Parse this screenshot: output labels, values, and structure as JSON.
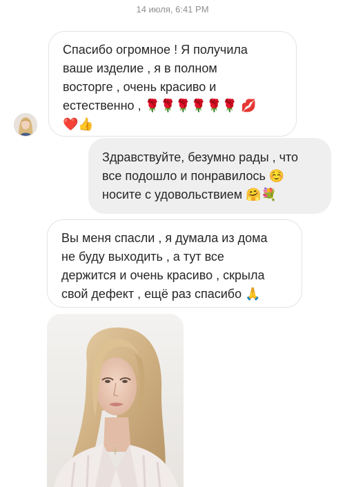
{
  "timestamp": "14 июля, 6:41 PM",
  "messages": [
    {
      "direction": "incoming",
      "lines": [
        "Спасибо огромное ! Я получила",
        "ваше изделие , я в полном",
        "восторге , очень красиво и",
        "естественно , 🌹🌹🌹🌹🌹🌹 💋",
        "❤️👍"
      ]
    },
    {
      "direction": "outgoing",
      "lines": [
        "Здравствуйте, безумно рады , что",
        "все подошло и понравилось ☺️",
        "носите с удовольствием 🤗💐"
      ]
    },
    {
      "direction": "incoming",
      "lines": [
        "Вы меня спасли , я думала из дома",
        "не буду выходить , а тут все",
        "держится и очень красиво , скрыла",
        "свой дефект , ещё раз спасибо 🙏"
      ]
    }
  ],
  "colors": {
    "incoming_bubble": "#ffffff",
    "incoming_border": "#e3e3e3",
    "outgoing_bubble": "#efefef",
    "text": "#262626",
    "timestamp": "#8e8e8e"
  },
  "images": [
    {
      "name": "sender-avatar",
      "content": "profile photo of a blonde woman"
    },
    {
      "name": "attached-photo",
      "content": "selfie of a woman with long blonde hair in a light pajama shirt"
    }
  ]
}
